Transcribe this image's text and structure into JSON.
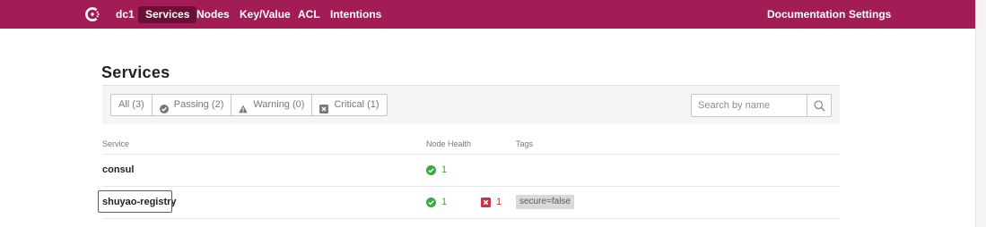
{
  "nav": {
    "datacenter": "dc1",
    "items": [
      {
        "label": "Services",
        "active": true
      },
      {
        "label": "Nodes",
        "active": false
      },
      {
        "label": "Key/Value",
        "active": false
      },
      {
        "label": "ACL",
        "active": false
      },
      {
        "label": "Intentions",
        "active": false
      }
    ],
    "right": [
      "Documentation",
      "Settings"
    ],
    "logo_icon": "consul-logo-icon"
  },
  "page": {
    "title": "Services"
  },
  "filters": [
    {
      "label": "All (3)",
      "icon": null
    },
    {
      "label": "Passing (2)",
      "icon": "check-circle-icon"
    },
    {
      "label": "Warning (0)",
      "icon": "warning-triangle-icon"
    },
    {
      "label": "Critical (1)",
      "icon": "x-square-icon"
    }
  ],
  "search": {
    "placeholder": "Search by name",
    "value": "",
    "icon": "magnifier-icon"
  },
  "table": {
    "columns": [
      "Service",
      "Node Health",
      "Tags"
    ],
    "rows": [
      {
        "name": "consul",
        "passing": "1",
        "critical": null,
        "tags": []
      },
      {
        "name": "shuyao-registry",
        "passing": "1",
        "critical": "1",
        "tags": [
          "secure=false"
        ]
      }
    ]
  },
  "colors": {
    "brand": "#a21d55",
    "nav_active": "#6b1035",
    "passing": "#2eb039",
    "critical": "#c73445",
    "highlight": "#d42a2a"
  }
}
